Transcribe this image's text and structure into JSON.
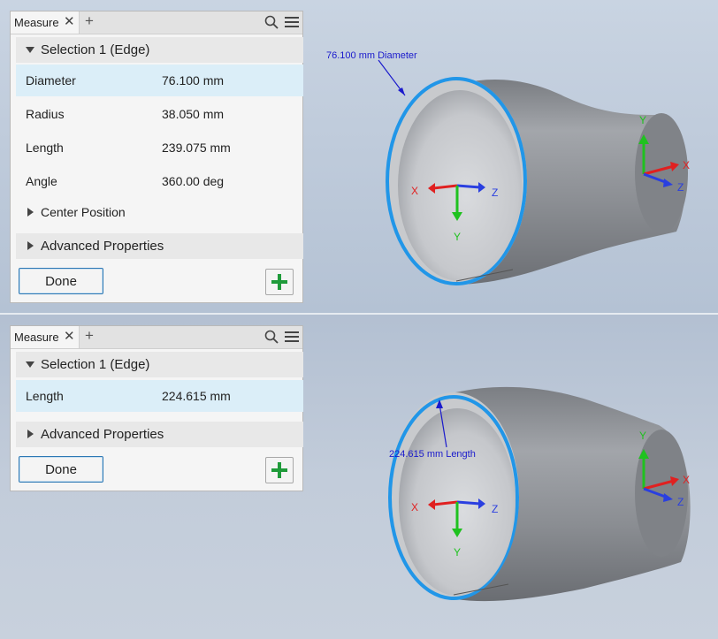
{
  "top": {
    "tab": {
      "label": "Measure",
      "close": "✕",
      "add": "+"
    },
    "selection_header": "Selection 1 (Edge)",
    "properties": [
      {
        "name": "Diameter",
        "value": "76.100 mm"
      },
      {
        "name": "Radius",
        "value": "38.050 mm"
      },
      {
        "name": "Length",
        "value": "239.075 mm"
      },
      {
        "name": "Angle",
        "value": "360.00 deg"
      }
    ],
    "center_position": "Center Position",
    "advanced": "Advanced Properties",
    "done": "Done",
    "annotation": "76.100 mm Diameter"
  },
  "bottom": {
    "tab": {
      "label": "Measure",
      "close": "✕",
      "add": "+"
    },
    "selection_header": "Selection 1 (Edge)",
    "properties": [
      {
        "name": "Length",
        "value": "224.615 mm"
      }
    ],
    "advanced": "Advanced Properties",
    "done": "Done",
    "annotation": "224.615 mm Length"
  },
  "axes": {
    "x": "X",
    "y": "Y",
    "z": "Z"
  },
  "colors": {
    "selection_edge": "#2196e8",
    "annotation_text": "#1a1acc",
    "axis_x": "#e02020",
    "axis_y": "#1fc21f",
    "axis_z": "#2a3fe0",
    "add_icon": "#1f9b3a"
  }
}
